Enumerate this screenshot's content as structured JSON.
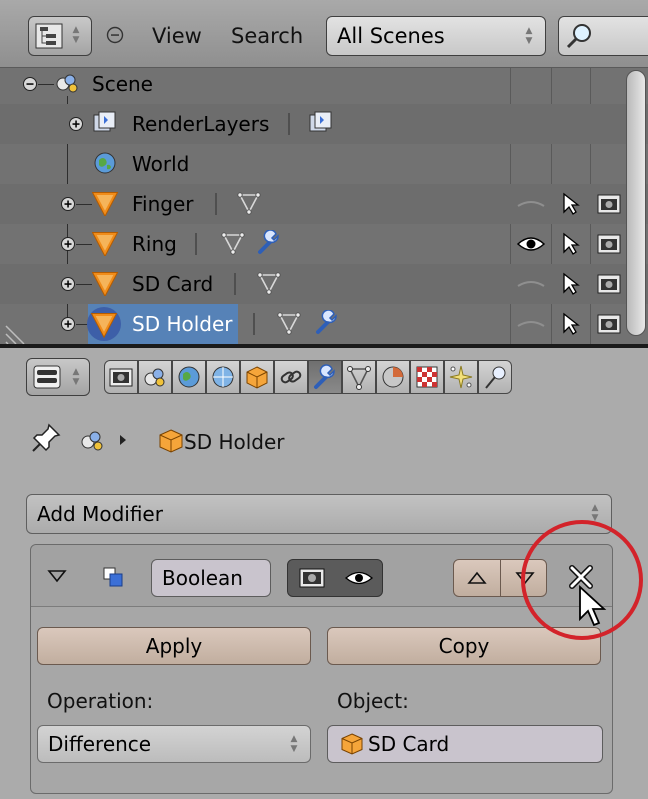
{
  "outliner": {
    "header": {
      "menu_view": "View",
      "menu_search": "Search",
      "display_mode": "All Scenes"
    },
    "tree": [
      {
        "label": "Scene",
        "icon": "scene-icon"
      },
      {
        "label": "RenderLayers",
        "icon": "render-layers-icon"
      },
      {
        "label": "World",
        "icon": "world-icon"
      },
      {
        "label": "Finger",
        "icon": "object-icon",
        "visible": false,
        "modifier": false
      },
      {
        "label": "Ring",
        "icon": "object-icon",
        "visible": true,
        "modifier": true
      },
      {
        "label": "SD Card",
        "icon": "object-icon",
        "visible": false,
        "modifier": false
      },
      {
        "label": "SD Holder",
        "icon": "object-icon",
        "visible": false,
        "modifier": true,
        "selected": true
      }
    ]
  },
  "properties": {
    "tabs": [
      "render",
      "render-layers",
      "scene",
      "world",
      "object",
      "constraints",
      "modifiers",
      "data",
      "material",
      "texture",
      "particles",
      "physics"
    ],
    "active_tab": "modifiers",
    "breadcrumb": {
      "object": "SD Holder"
    },
    "add_modifier_label": "Add Modifier",
    "modifier": {
      "name": "Boolean",
      "apply_label": "Apply",
      "copy_label": "Copy",
      "operation_label": "Operation:",
      "operation_value": "Difference",
      "object_label": "Object:",
      "object_value": "SD Card"
    }
  },
  "colors": {
    "selection": "#5682b7",
    "highlight_circle": "#d3232a",
    "object_orange": "#f08c1a",
    "modifier_blue": "#3b6fd6"
  }
}
